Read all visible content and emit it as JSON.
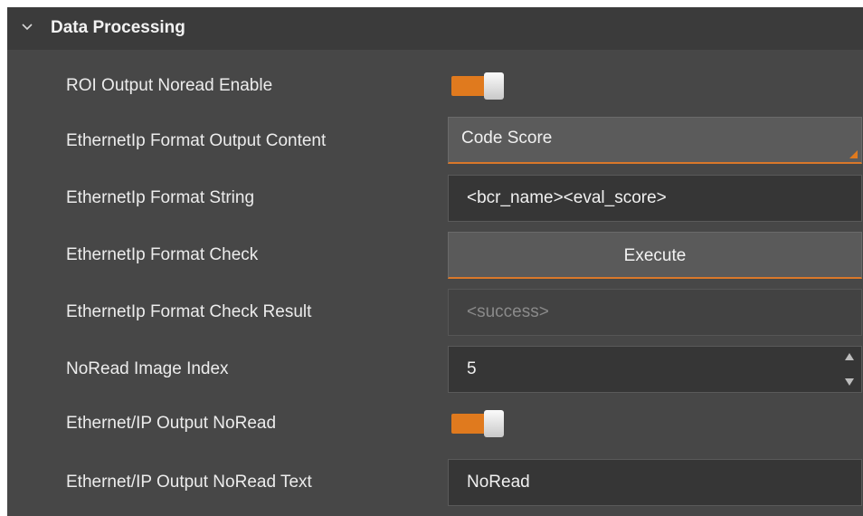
{
  "section": {
    "title": "Data Processing"
  },
  "rows": {
    "roi_output_noread_enable": {
      "label": "ROI Output Noread Enable",
      "enabled": true
    },
    "ethernetip_format_output_content": {
      "label": "EthernetIp Format Output Content",
      "value": "Code Score"
    },
    "ethernetip_format_string": {
      "label": "EthernetIp Format String",
      "value": "<bcr_name><eval_score>"
    },
    "ethernetip_format_check": {
      "label": "EthernetIp Format Check",
      "button": "Execute"
    },
    "ethernetip_format_check_result": {
      "label": "EthernetIp Format Check Result",
      "value": "<success>"
    },
    "noread_image_index": {
      "label": "NoRead Image Index",
      "value": "5"
    },
    "ethernet_ip_output_noread": {
      "label": "Ethernet/IP Output NoRead",
      "enabled": true
    },
    "ethernet_ip_output_noread_text": {
      "label": "Ethernet/IP Output NoRead Text",
      "value": "NoRead"
    }
  },
  "icons": {
    "collapse": "chevron-down-icon",
    "spin_up": "triangle-up-icon",
    "spin_down": "triangle-down-icon"
  },
  "colors": {
    "accent": "#e07a1e",
    "panel_bg": "#474747",
    "header_bg": "#3b3b3b",
    "input_bg": "#363636"
  }
}
